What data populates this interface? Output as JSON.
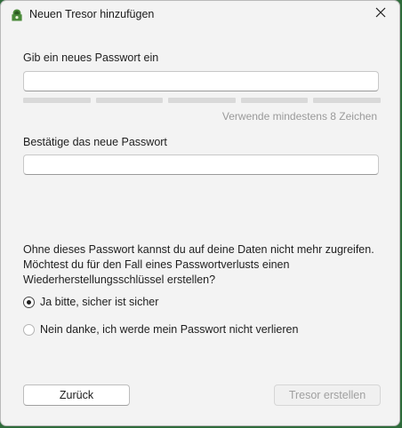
{
  "window": {
    "title": "Neuen Tresor hinzufügen",
    "app_icon": "cryptomator-vault-icon",
    "close_icon": "close-icon"
  },
  "password": {
    "label": "Gib ein neues Passwort ein",
    "value": "",
    "strength_segments_filled": 0,
    "strength_segments_total": 5,
    "hint": "Verwende mindestens 8 Zeichen"
  },
  "confirm": {
    "label": "Bestätige das neue Passwort",
    "value": ""
  },
  "recovery": {
    "info": "Ohne dieses Passwort kannst du auf deine Daten nicht mehr zugreifen. Möchtest du für den Fall eines Passwortverlusts einen Wiederherstellungsschlüssel erstellen?",
    "options": [
      {
        "label": "Ja bitte, sicher ist sicher",
        "selected": true
      },
      {
        "label": "Nein danke, ich werde mein Passwort nicht verlieren",
        "selected": false
      }
    ]
  },
  "buttons": {
    "back": "Zurück",
    "create": "Tresor erstellen",
    "create_enabled": false
  },
  "colors": {
    "accent_disabled_text": "#a0a0a0",
    "strength_empty": "#d9d9d9",
    "hint_text": "#9a9a9a"
  }
}
